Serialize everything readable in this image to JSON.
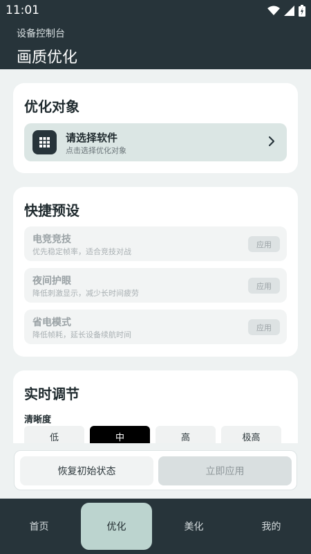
{
  "status_bar": {
    "time": "11:01"
  },
  "header": {
    "subtitle": "设备控制台",
    "title": "画质优化"
  },
  "target_card": {
    "title": "优化对象",
    "select_title": "请选择软件",
    "select_subtitle": "点击选择优化对象"
  },
  "presets_card": {
    "title": "快捷预设",
    "items": [
      {
        "name": "电竞竞技",
        "desc": "优先稳定帧率，适合竞技对战",
        "apply": "应用"
      },
      {
        "name": "夜间护眼",
        "desc": "降低刺激显示，减少长时间疲劳",
        "apply": "应用"
      },
      {
        "name": "省电模式",
        "desc": "降低帧耗，延长设备续航时间",
        "apply": "应用"
      }
    ]
  },
  "realtime_card": {
    "title": "实时调节",
    "clarity_label": "清晰度",
    "options": [
      "低",
      "中",
      "高",
      "极高"
    ],
    "selected": "中"
  },
  "actions": {
    "reset": "恢复初始状态",
    "apply_now": "立即应用"
  },
  "bottom_nav": {
    "items": [
      "首页",
      "优化",
      "美化",
      "我的"
    ],
    "active": "优化"
  },
  "colors": {
    "dark": "#27343a",
    "accent_active_nav": "#bcd4cf",
    "background": "#eef2f2"
  }
}
